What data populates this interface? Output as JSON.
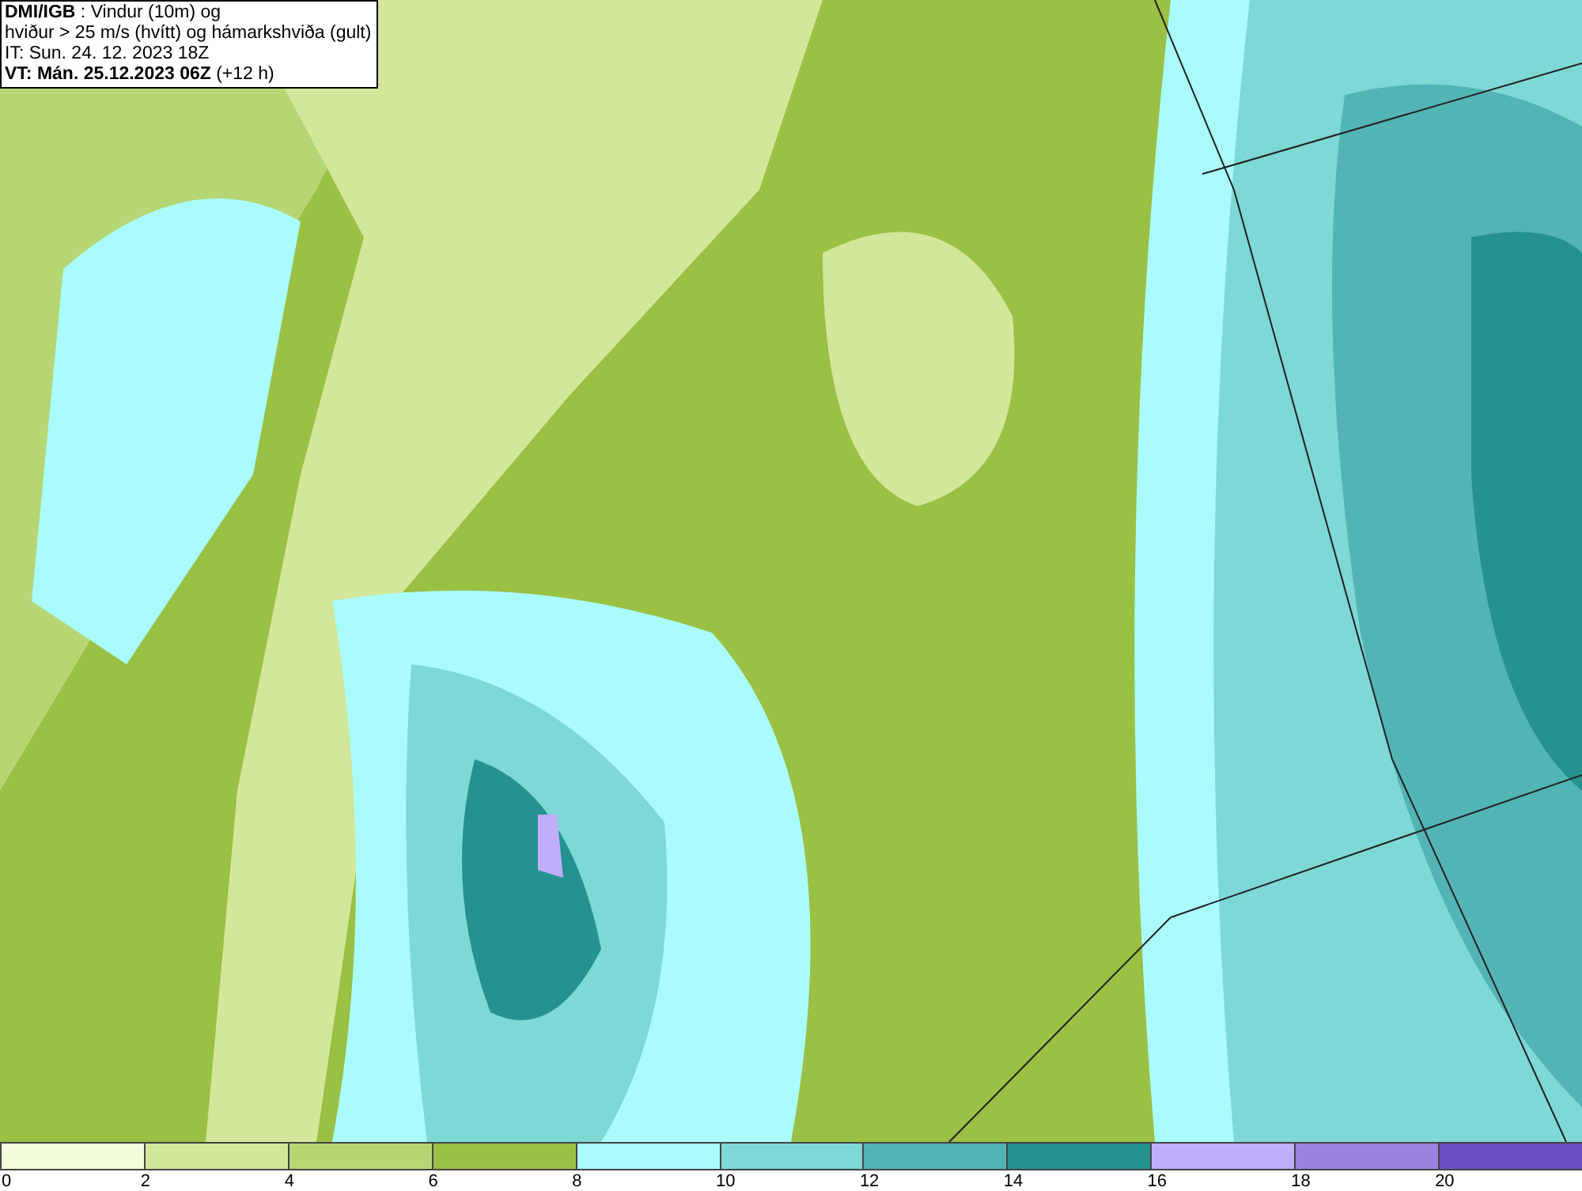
{
  "title_box": {
    "lines": [
      "**DMI/IGB** : Vindur (10m) og",
      "hviður > 25 m/s (hvítt) og hámarkshviða (gult)",
      "IT: Sun. 24. 12. 2023 18Z",
      "**VT: Mán. 25.12.2023 06Z** (+12 h)"
    ]
  },
  "legend": {
    "bins": [
      {
        "label": "0",
        "color": "#f2fbdc"
      },
      {
        "label": "2",
        "color": "#d2e79a"
      },
      {
        "label": "4",
        "color": "#b5d673"
      },
      {
        "label": "6",
        "color": "#9ac044"
      },
      {
        "label": "8",
        "color": "#aafcfc"
      },
      {
        "label": "10",
        "color": "#7ed8d6"
      },
      {
        "label": "12",
        "color": "#52b4b4"
      },
      {
        "label": "14",
        "color": "#25928f"
      },
      {
        "label": "16",
        "color": "#c0aefc"
      },
      {
        "label": "18",
        "color": "#9a82e0"
      },
      {
        "label": "20",
        "color": "#6a4ec4"
      }
    ]
  }
}
